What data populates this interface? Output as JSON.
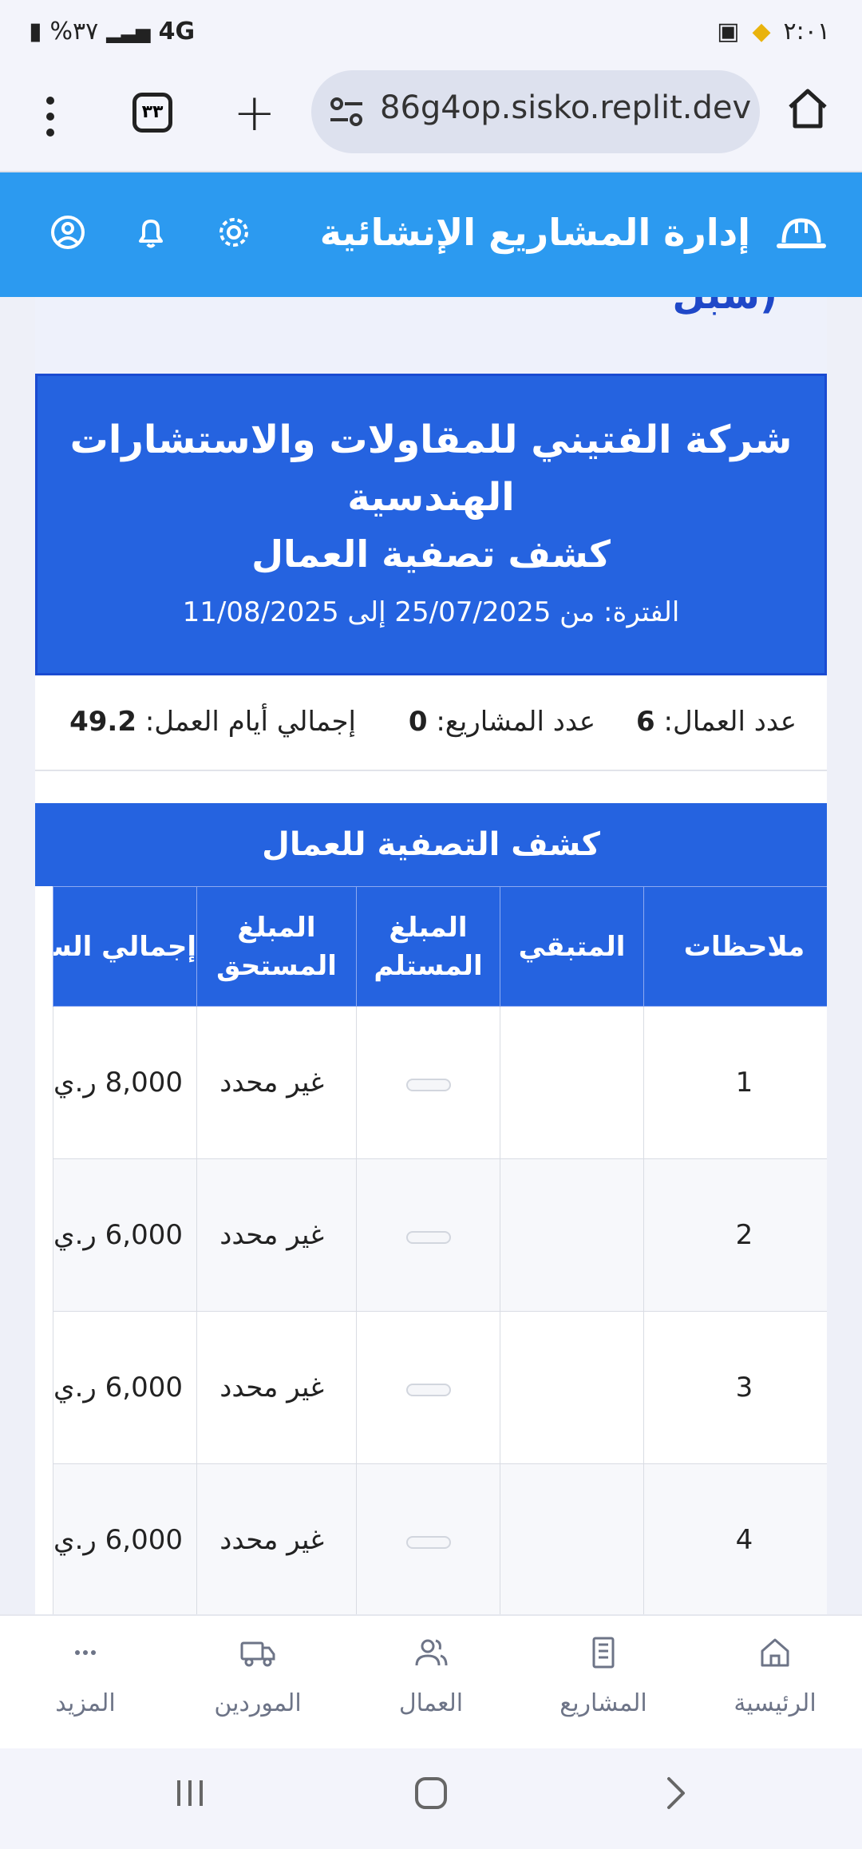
{
  "status_bar": {
    "time": "٢:٠١",
    "battery": "%٣٧",
    "network": "4G"
  },
  "browser": {
    "url": "86g4op.sisko.replit.dev",
    "tab_count": "٣٣"
  },
  "app_bar": {
    "title": "إدارة المشاريع الإنشائية"
  },
  "report": {
    "top_cut_text": "سبل)",
    "company_name": "شركة الفتيني للمقاولات والاستشارات الهندسية",
    "subtitle": "كشف تصفية العمال",
    "period": "الفترة: من 25/07/2025 إلى 11/08/2025",
    "stats": {
      "workers_label": "عدد العمال:",
      "workers_value": "6",
      "projects_label": "عدد المشاريع:",
      "projects_value": "0",
      "days_label": "إجمالي أيام العمل:",
      "days_value": "49.2"
    },
    "table_title": "كشف التصفية للعمال",
    "columns": {
      "notes": "ملاحظات",
      "remaining": "المتبقي",
      "received": "المبلغ المستلم",
      "due": "المبلغ المستحق",
      "total_hours": "إجمالي الساعات"
    },
    "rows": [
      {
        "notes": "1",
        "due": "غير محدد",
        "total": "8,000 ر.ي"
      },
      {
        "notes": "2",
        "due": "غير محدد",
        "total": "6,000 ر.ي"
      },
      {
        "notes": "3",
        "due": "غير محدد",
        "total": "6,000 ر.ي"
      },
      {
        "notes": "4",
        "due": "غير محدد",
        "total": "6,000 ر.ي"
      }
    ]
  },
  "bottom_nav": {
    "home": "الرئيسية",
    "projects": "المشاريع",
    "workers": "العمال",
    "suppliers": "الموردين",
    "more": "المزيد"
  },
  "colors": {
    "app_bar": "#2c9af0",
    "report_blue": "#2563e0",
    "nav_gray": "#6d7487"
  }
}
